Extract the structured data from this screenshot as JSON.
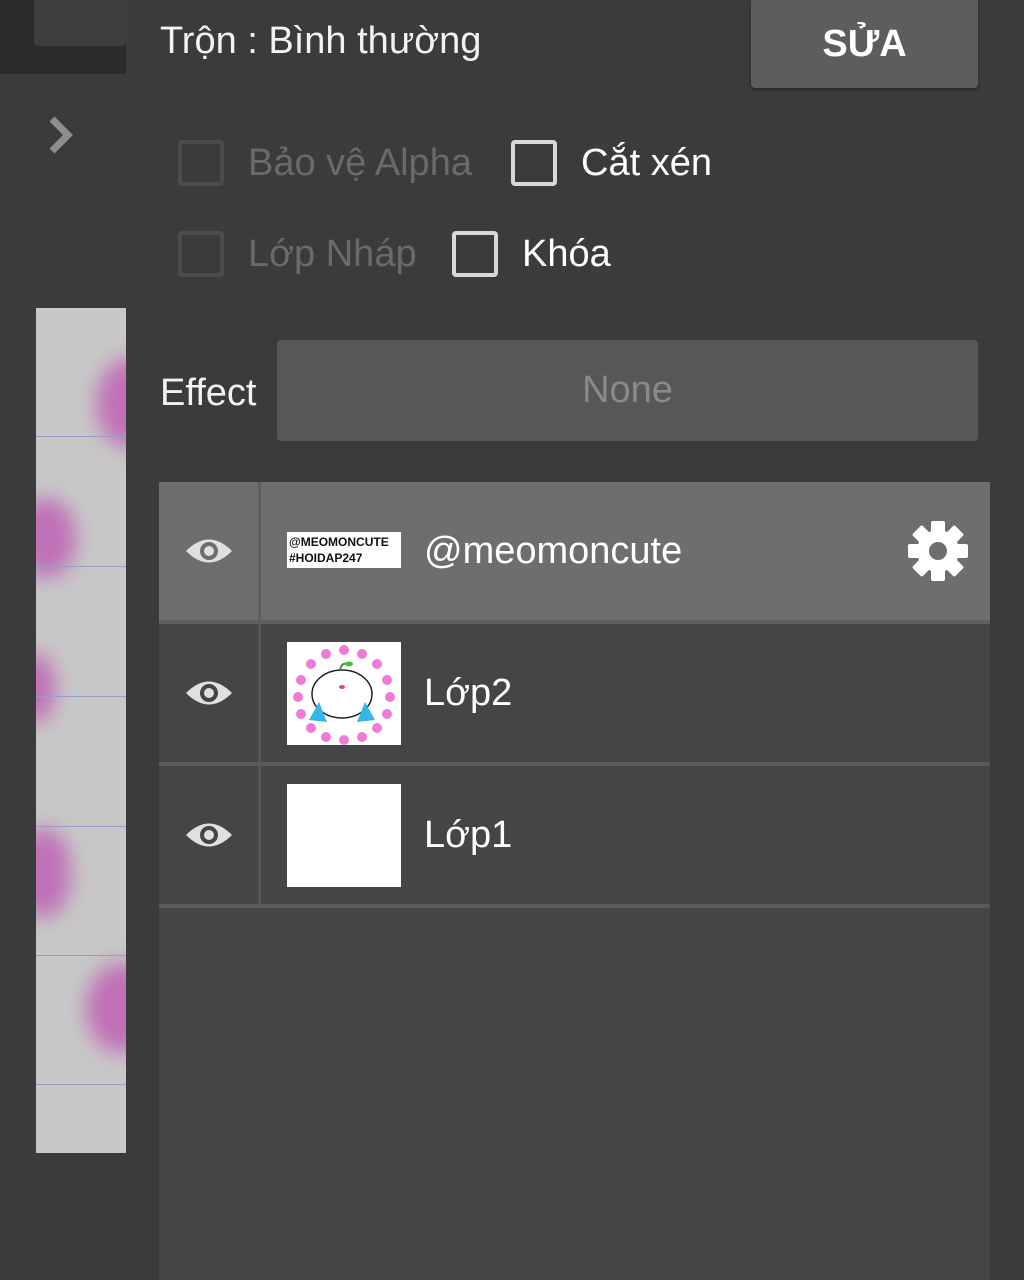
{
  "blend": {
    "label": "Trộn : Bình thường"
  },
  "edit_button": {
    "label": "SỬA"
  },
  "options": {
    "alpha_protect": {
      "label": "Bảo vệ Alpha",
      "checked": false,
      "enabled": false
    },
    "clipping": {
      "label": "Cắt xén",
      "checked": false,
      "enabled": true
    },
    "draft_layer": {
      "label": "Lớp Nháp",
      "checked": false,
      "enabled": false
    },
    "lock": {
      "label": "Khóa",
      "checked": false,
      "enabled": true
    }
  },
  "effect": {
    "label": "Effect",
    "value": "None"
  },
  "layers": [
    {
      "name": "@meomoncute",
      "thumb_text": [
        "@MEOMONCUTE",
        "#HOIDAP247"
      ],
      "selected": true,
      "visible": true,
      "icons": [
        "eye-icon",
        "gear-icon"
      ]
    },
    {
      "name": "Lớp2",
      "selected": false,
      "visible": true,
      "icons": [
        "eye-icon"
      ]
    },
    {
      "name": "Lớp1",
      "selected": false,
      "visible": true,
      "icons": [
        "eye-icon"
      ]
    }
  ],
  "nav": {
    "expand_icon": "chevron-right-icon"
  },
  "colors": {
    "panel_bg": "#3b3b3b",
    "selected_row": "#6e6e6e",
    "button_bg": "#5d5d5d",
    "text": "#ffffff",
    "disabled_text": "#6a6a6a"
  }
}
